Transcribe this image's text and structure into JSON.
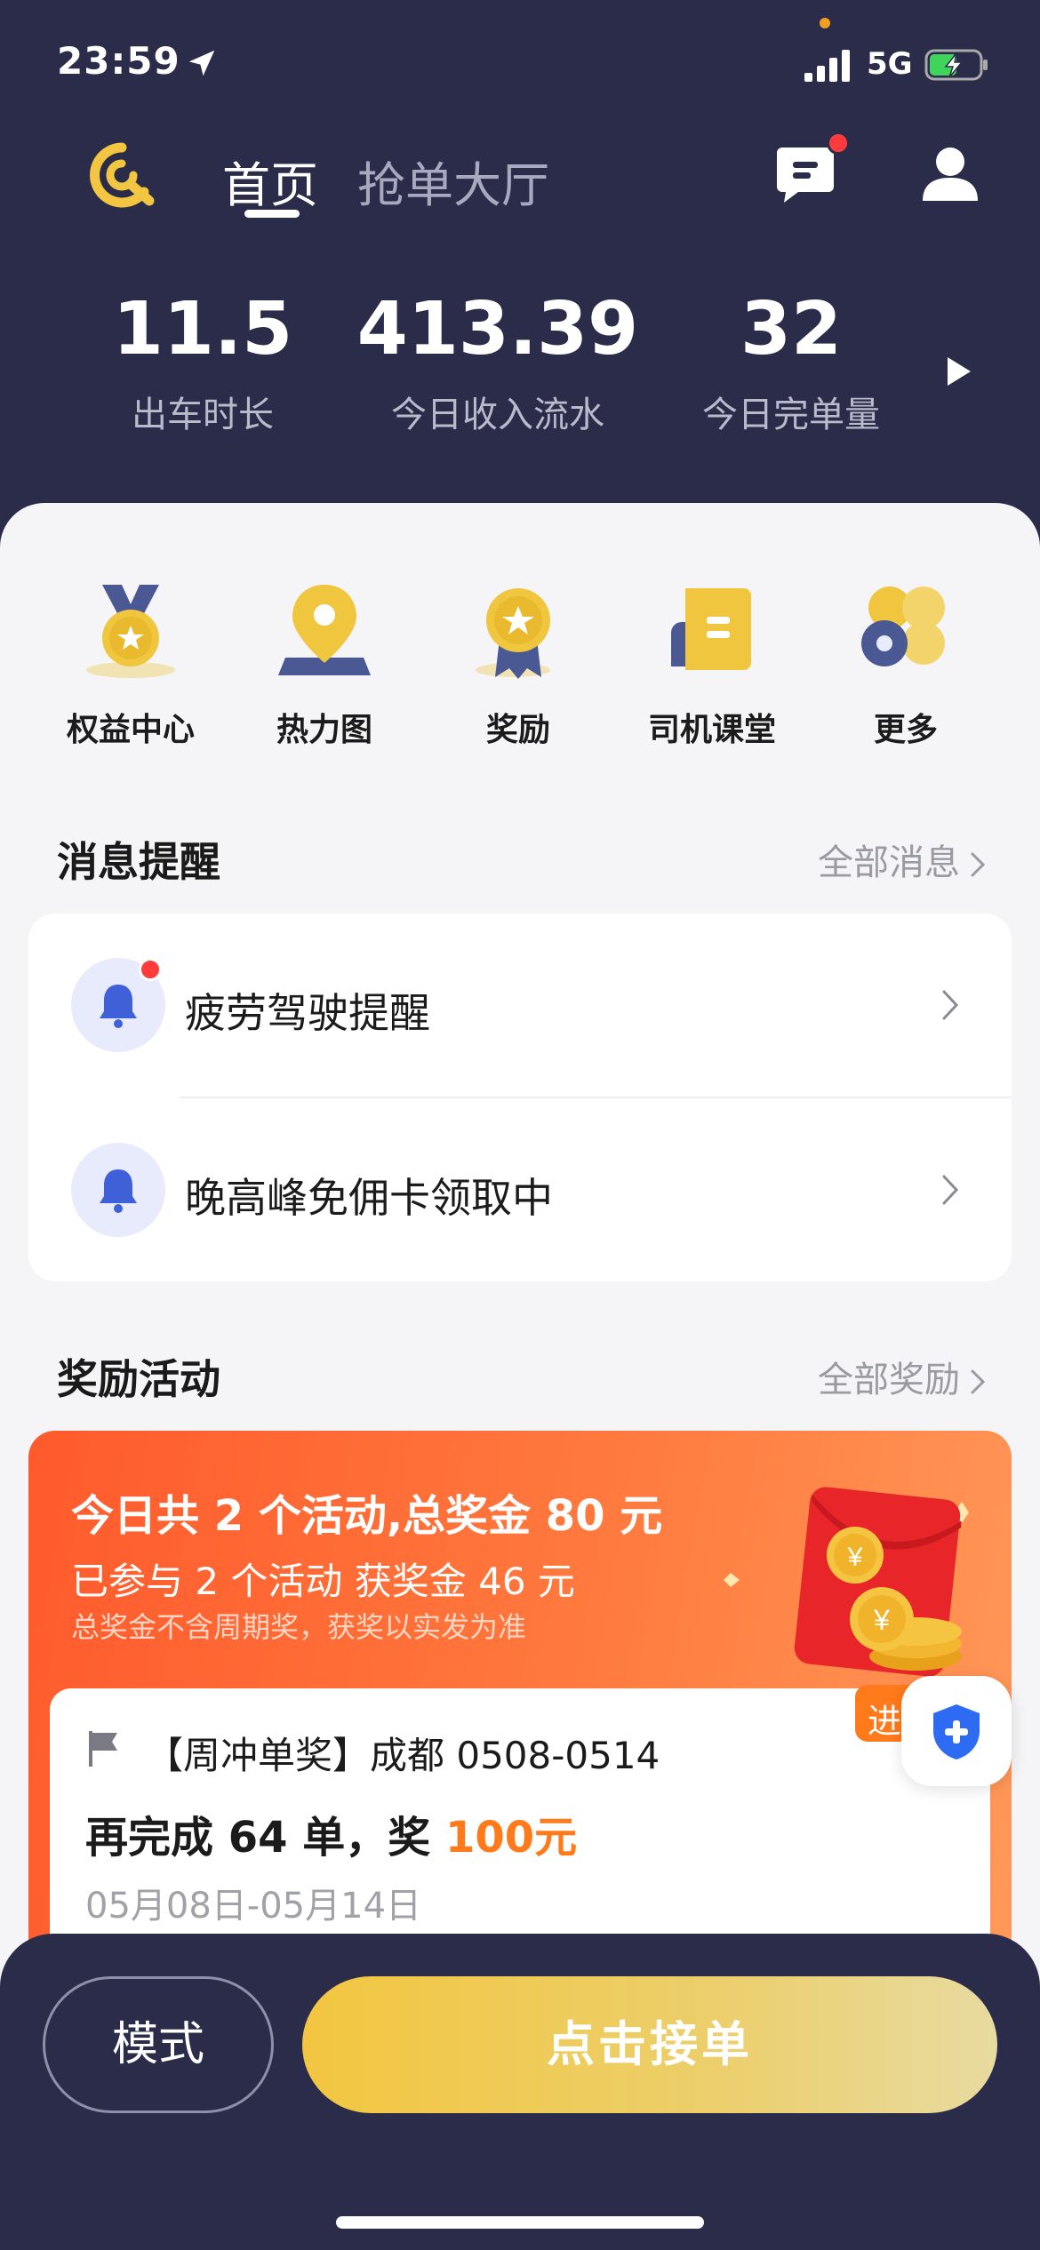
{
  "status_bar": {
    "time": "23:59",
    "network": "5G"
  },
  "nav": {
    "tabs": [
      {
        "label": "首页"
      },
      {
        "label": "抢单大厅"
      }
    ]
  },
  "stats": [
    {
      "value": "11.5",
      "label": "出车时长"
    },
    {
      "value": "413.39",
      "label": "今日收入流水"
    },
    {
      "value": "32",
      "label": "今日完单量"
    }
  ],
  "quick_entries": [
    {
      "label": "权益中心",
      "icon": "medal-icon"
    },
    {
      "label": "热力图",
      "icon": "map-pin-icon"
    },
    {
      "label": "奖励",
      "icon": "award-icon"
    },
    {
      "label": "司机课堂",
      "icon": "book-icon"
    },
    {
      "label": "更多",
      "icon": "more-icon"
    }
  ],
  "messages": {
    "title": "消息提醒",
    "link": "全部消息",
    "items": [
      {
        "text": "疲劳驾驶提醒",
        "unread": true
      },
      {
        "text": "晚高峰免佣卡领取中",
        "unread": false
      }
    ]
  },
  "rewards": {
    "title": "奖励活动",
    "link": "全部奖励",
    "banner": {
      "headline": "今日共 2 个活动,总奖金 80 元",
      "sub": "已参与 2 个活动 获奖金 46 元",
      "note": "总奖金不含周期奖，获奖以实发为准"
    },
    "task": {
      "name": "【周冲单奖】成都 0508-0514",
      "goal_prefix": "再完成 64 单，奖 ",
      "goal_amount": "100元",
      "date_range": "05月08日-05月14日"
    },
    "side_tag": "进"
  },
  "bottom_bar": {
    "mode_label": "模式",
    "accept_label": "点击接单"
  },
  "colors": {
    "background": "#2b2c4a",
    "accent": "#f2c640",
    "orange": "#ff7a1a",
    "alert": "#ff3b3b"
  }
}
